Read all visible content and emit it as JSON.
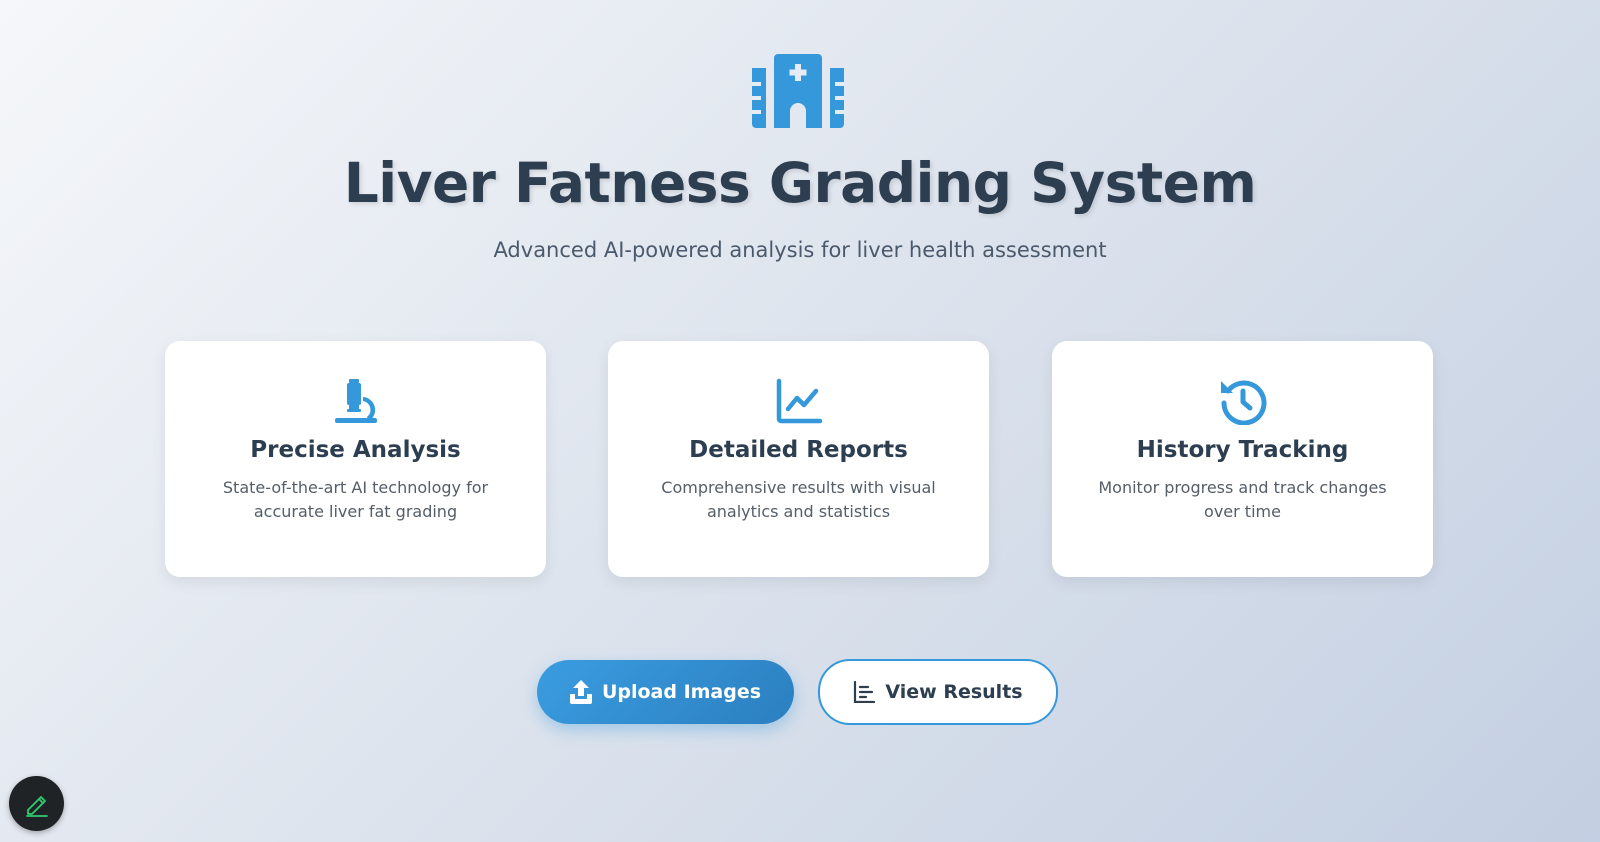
{
  "colors": {
    "accent": "#3498db",
    "heading": "#2c3e50",
    "fab_bg": "#1f2326",
    "fab_icon": "#2ecc71"
  },
  "hero": {
    "icon": "hospital-icon",
    "title": "Liver Fatness Grading System",
    "subtitle": "Advanced AI-powered analysis for liver health assessment"
  },
  "features": [
    {
      "icon": "microscope-icon",
      "title": "Precise Analysis",
      "text": "State-of-the-art AI technology for accurate liver fat grading"
    },
    {
      "icon": "line-chart-icon",
      "title": "Detailed Reports",
      "text": "Comprehensive results with visual analytics and statistics"
    },
    {
      "icon": "history-icon",
      "title": "History Tracking",
      "text": "Monitor progress and track changes over time"
    }
  ],
  "actions": {
    "upload": {
      "label": "Upload Images",
      "icon": "upload-icon"
    },
    "results": {
      "label": "View Results",
      "icon": "list-icon"
    }
  },
  "fab": {
    "icon": "pencil-icon"
  }
}
